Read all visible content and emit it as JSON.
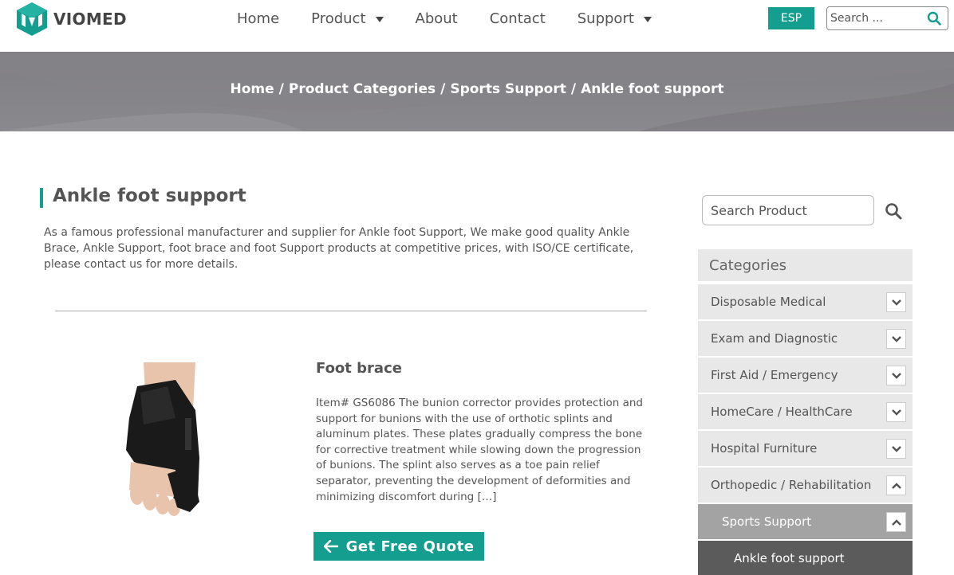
{
  "header": {
    "brand": "VIOMED",
    "nav": [
      {
        "label": "Home",
        "has_dropdown": false
      },
      {
        "label": "Product",
        "has_dropdown": true
      },
      {
        "label": "About",
        "has_dropdown": false
      },
      {
        "label": "Contact",
        "has_dropdown": false
      },
      {
        "label": "Support",
        "has_dropdown": true
      }
    ],
    "language_button": "ESP",
    "search_placeholder": "Search ...",
    "accent_color": "#139e8f"
  },
  "breadcrumb": {
    "items": [
      "Home",
      "Product Categories",
      "Sports Support",
      "Ankle foot support"
    ],
    "separator": "/"
  },
  "main": {
    "title": "Ankle foot support",
    "intro": "As a famous professional manufacturer and supplier for Ankle foot Support, We make good quality Ankle Brace, Ankle Support, foot brace and foot Support products at competitive prices, with ISO/CE certificate, please contact us for more details.",
    "product": {
      "name": "Foot brace",
      "description": "Item# GS6086 The bunion corrector provides protection and support for bunions with the use of orthotic splints and aluminum plates. These plates gradually compress the bone for corrective treatment while slowing down the progression of bunions. The splint also serves as a toe pain relief separator, preventing the development of deformities and minimizing discomfort during […]",
      "quote_button": "Get Free Quote"
    }
  },
  "sidebar": {
    "search_placeholder": "Search Product",
    "categories_title": "Categories",
    "categories": [
      {
        "label": "Disposable Medical",
        "toggle": "collapsed"
      },
      {
        "label": "Exam and Diagnostic",
        "toggle": "collapsed"
      },
      {
        "label": "First Aid / Emergency",
        "toggle": "collapsed"
      },
      {
        "label": "HomeCare / HealthCare",
        "toggle": "collapsed"
      },
      {
        "label": "Hospital Furniture",
        "toggle": "collapsed"
      },
      {
        "label": "Orthopedic / Rehabilitation",
        "toggle": "expanded"
      }
    ],
    "subcategory": {
      "label": "Sports Support",
      "toggle": "expanded"
    },
    "active_item": "Ankle foot support"
  }
}
